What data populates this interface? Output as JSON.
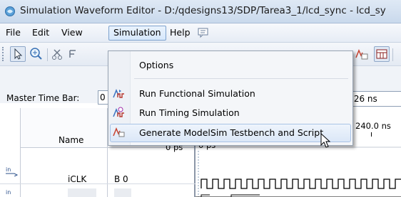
{
  "window": {
    "title": "Simulation Waveform Editor - D:/qdesigns13/SDP/Tarea3_1/lcd_sync - lcd_sy"
  },
  "menubar": {
    "items": [
      "File",
      "Edit",
      "View",
      "Simulation",
      "Help"
    ],
    "active": "Simulation"
  },
  "toolbar": {
    "left_icons": [
      "pointer-icon",
      "zoom-icon",
      "cut-icon",
      "grid-icon"
    ],
    "right_icons": [
      "modelsim-icon",
      "snap-grid-icon"
    ]
  },
  "master_time_bar": {
    "label": "Master Time Bar:",
    "value": "0",
    "right_value": ".26 ns"
  },
  "grid": {
    "name_header": "Name",
    "value_header": "0 ps",
    "wave_start": "0 ps",
    "wave_mark": "240.0 ns",
    "rows": [
      {
        "name": "iCLK",
        "value": "B 0"
      }
    ]
  },
  "dropdown": {
    "items": [
      {
        "label": "Options",
        "icon": ""
      },
      {
        "label": "Run Functional Simulation",
        "icon": "functional-sim-icon"
      },
      {
        "label": "Run Timing Simulation",
        "icon": "timing-sim-icon"
      },
      {
        "label": "Generate ModelSim Testbench and Script",
        "icon": "modelsim-icon",
        "highlighted": true
      }
    ]
  },
  "colors": {
    "highlight": "#dbe7f7",
    "accent": "#7da2ce"
  }
}
